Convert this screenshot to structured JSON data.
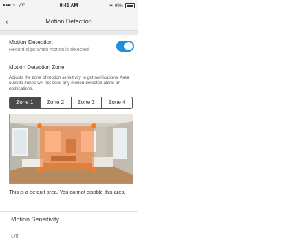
{
  "status_bar": {
    "carrier": "●●●○○ Lyric",
    "time": "9:41 AM",
    "battery_text": "99%"
  },
  "nav": {
    "back_icon": "chevron-left-icon",
    "title": "Motion Detection"
  },
  "motion_detection": {
    "label": "Motion Detection",
    "sublabel": "Record clips when motion is detected",
    "enabled": true,
    "accent": "#1f8fdb"
  },
  "zone": {
    "title": "Motion Detection Zone",
    "description": "Adjusts the zone of motion sensitivity to get notifications. Area outside zones will not send any motion detected alerts or notifications.",
    "tabs": [
      {
        "label": "Zone 1",
        "active": true
      },
      {
        "label": "Zone 2",
        "active": false
      },
      {
        "label": "Zone 3",
        "active": false
      },
      {
        "label": "Zone 4",
        "active": false
      }
    ],
    "overlay_color": "#ff7a1a",
    "note": "This is a default area. You cannot disable this area."
  },
  "sensitivity": {
    "title": "Motion Sensitivity",
    "value": "Off"
  }
}
